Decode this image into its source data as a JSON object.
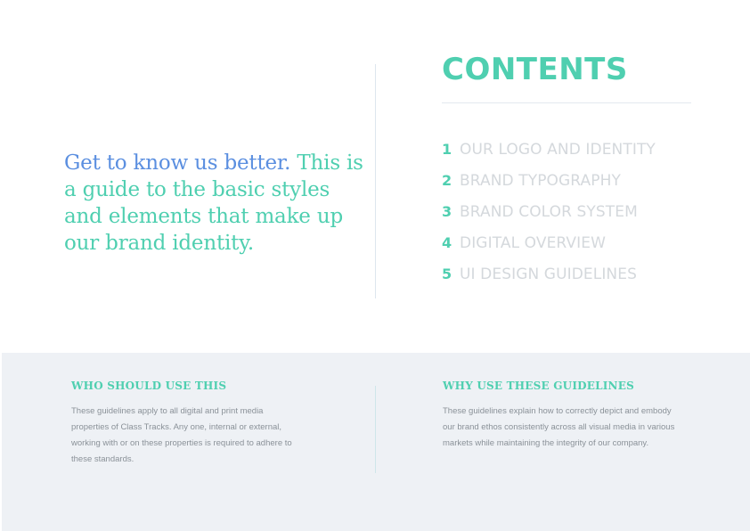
{
  "intro": {
    "lead": "Get to know us better.",
    "text": "This is a guide to the basic styles and elements that make up our brand identity."
  },
  "contents": {
    "title": "CONTENTS",
    "items": [
      {
        "number": "1",
        "label": "OUR LOGO AND IDENTITY"
      },
      {
        "number": "2",
        "label": "BRAND TYPOGRAPHY"
      },
      {
        "number": "3",
        "label": "BRAND COLOR SYSTEM"
      },
      {
        "number": "4",
        "label": "DIGITAL OVERVIEW"
      },
      {
        "number": "5",
        "label": "UI DESIGN GUIDELINES"
      }
    ]
  },
  "who": {
    "heading": "WHO SHOULD USE THIS",
    "lines": [
      "These guidelines apply to all digital and print media",
      "properties of Class Tracks. Any one, internal or external,",
      "working with or on these properties is required to adhere to",
      "these standards."
    ]
  },
  "why": {
    "heading": "WHY USE THESE GUIDELINES",
    "lines": [
      "These guidelines explain how to correctly depict and embody",
      "our brand ethos consistently  across all visual media in various",
      "markets while maintaining the integrity of our company."
    ]
  },
  "colors": {
    "accent": "#4fcfb0",
    "blue": "#5b8fe0",
    "muted": "#d4d8dc",
    "panel": "#eef1f5"
  }
}
